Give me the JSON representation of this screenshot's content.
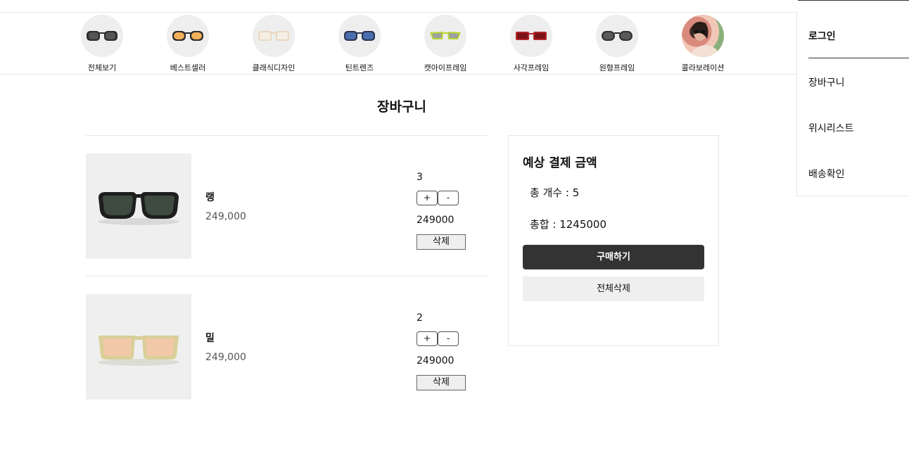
{
  "categories": [
    {
      "label": "전체보기",
      "icon": "sunglasses-black-icon"
    },
    {
      "label": "베스트셀러",
      "icon": "sunglasses-orange-icon"
    },
    {
      "label": "클래식디자인",
      "icon": "glasses-clear-icon"
    },
    {
      "label": "틴트렌즈",
      "icon": "sunglasses-blue-icon"
    },
    {
      "label": "캣아이프레임",
      "icon": "sunglasses-lime-icon"
    },
    {
      "label": "사각프레임",
      "icon": "sunglasses-red-icon"
    },
    {
      "label": "원형프레임",
      "icon": "sunglasses-round-icon"
    },
    {
      "label": "콜라보레이션",
      "icon": "collaboration-photo-icon"
    }
  ],
  "side_menu": {
    "login": "로그인",
    "cart": "장바구니",
    "wishlist": "위시리스트",
    "delivery": "배송확인"
  },
  "cart": {
    "title": "장바구니",
    "items": [
      {
        "name": "랭",
        "price": "249,000",
        "qty": "3",
        "plus": "+",
        "minus": "-",
        "line_total": "249000",
        "delete_label": "삭제",
        "image": "black-sunglasses-photo"
      },
      {
        "name": "밀",
        "price": "249,000",
        "qty": "2",
        "plus": "+",
        "minus": "-",
        "line_total": "249000",
        "delete_label": "삭제",
        "image": "beige-sunglasses-photo"
      }
    ]
  },
  "summary": {
    "title": "예상 결제 금액",
    "total_count": "총 개수 : 5",
    "total_sum": "총합 : 1245000",
    "buy_label": "구매하기",
    "clear_label": "전체삭제"
  },
  "colors": {
    "buy_button": "#333333",
    "thumb_bg": "#efefef"
  }
}
